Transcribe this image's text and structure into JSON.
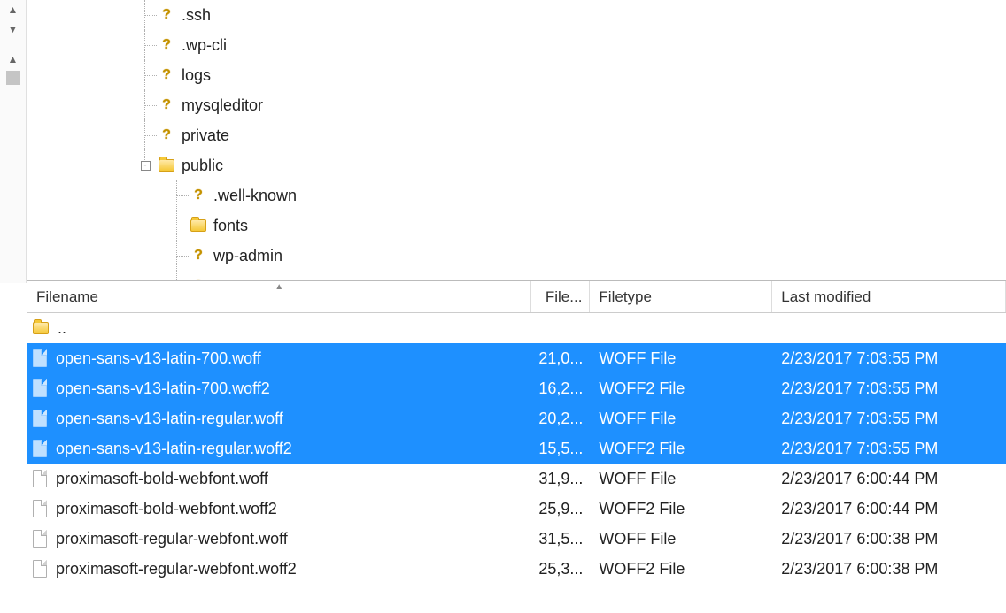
{
  "tree": [
    {
      "level": 0,
      "icon": "question",
      "label": ".ssh",
      "last": false
    },
    {
      "level": 0,
      "icon": "question",
      "label": ".wp-cli",
      "last": false
    },
    {
      "level": 0,
      "icon": "question",
      "label": "logs",
      "last": false
    },
    {
      "level": 0,
      "icon": "question",
      "label": "mysqleditor",
      "last": false
    },
    {
      "level": 0,
      "icon": "question",
      "label": "private",
      "last": false
    },
    {
      "level": 0,
      "icon": "folder",
      "label": "public",
      "toggle": "-",
      "last": true
    },
    {
      "level": 1,
      "icon": "question",
      "label": ".well-known",
      "last": false
    },
    {
      "level": 1,
      "icon": "folder",
      "label": "fonts",
      "last": false,
      "selected": true
    },
    {
      "level": 1,
      "icon": "question",
      "label": "wp-admin",
      "last": false
    },
    {
      "level": 1,
      "icon": "question",
      "label": "wp-content",
      "last": false
    }
  ],
  "columns": {
    "name": "Filename",
    "size": "File...",
    "type": "Filetype",
    "modified": "Last modified"
  },
  "parent_label": "..",
  "files": [
    {
      "icon": "blue",
      "name": "open-sans-v13-latin-700.woff",
      "size": "21,0...",
      "type": "WOFF File",
      "modified": "2/23/2017 7:03:55 PM",
      "selected": true
    },
    {
      "icon": "blue",
      "name": "open-sans-v13-latin-700.woff2",
      "size": "16,2...",
      "type": "WOFF2 File",
      "modified": "2/23/2017 7:03:55 PM",
      "selected": true
    },
    {
      "icon": "blue",
      "name": "open-sans-v13-latin-regular.woff",
      "size": "20,2...",
      "type": "WOFF File",
      "modified": "2/23/2017 7:03:55 PM",
      "selected": true
    },
    {
      "icon": "blue",
      "name": "open-sans-v13-latin-regular.woff2",
      "size": "15,5...",
      "type": "WOFF2 File",
      "modified": "2/23/2017 7:03:55 PM",
      "selected": true
    },
    {
      "icon": "plain",
      "name": "proximasoft-bold-webfont.woff",
      "size": "31,9...",
      "type": "WOFF File",
      "modified": "2/23/2017 6:00:44 PM",
      "selected": false
    },
    {
      "icon": "plain",
      "name": "proximasoft-bold-webfont.woff2",
      "size": "25,9...",
      "type": "WOFF2 File",
      "modified": "2/23/2017 6:00:44 PM",
      "selected": false
    },
    {
      "icon": "plain",
      "name": "proximasoft-regular-webfont.woff",
      "size": "31,5...",
      "type": "WOFF File",
      "modified": "2/23/2017 6:00:38 PM",
      "selected": false
    },
    {
      "icon": "plain",
      "name": "proximasoft-regular-webfont.woff2",
      "size": "25,3...",
      "type": "WOFF2 File",
      "modified": "2/23/2017 6:00:38 PM",
      "selected": false
    }
  ]
}
